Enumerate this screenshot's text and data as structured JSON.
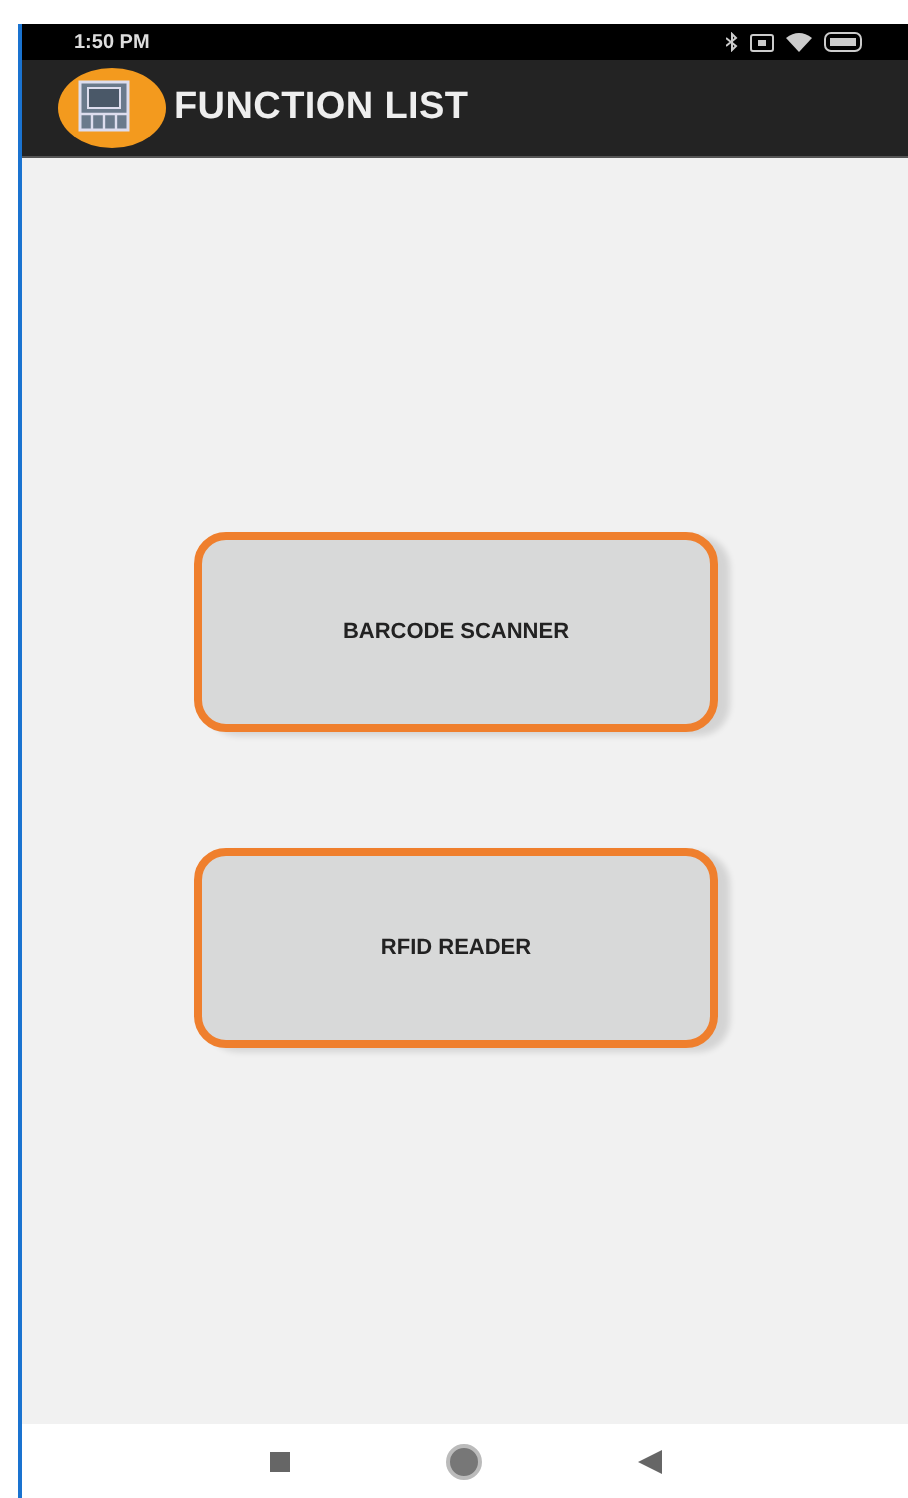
{
  "status_bar": {
    "time": "1:50 PM"
  },
  "app_bar": {
    "title": "FUNCTION LIST"
  },
  "buttons": [
    {
      "label": "BARCODE SCANNER"
    },
    {
      "label": "RFID READER"
    }
  ]
}
